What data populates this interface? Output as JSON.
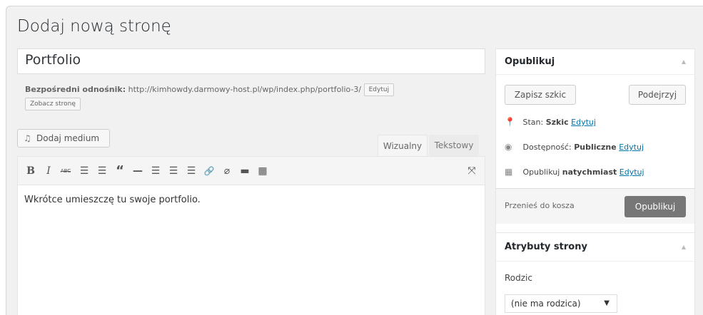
{
  "page": {
    "title": "Dodaj nową stronę"
  },
  "editor": {
    "post_title": "Portfolio",
    "permalink": {
      "label": "Bezpośredni odnośnik:",
      "url": "http://kimhowdy.darmowy-host.pl/wp/index.php/portfolio-3/",
      "edit_label": "Edytuj",
      "view_label": "Zobacz stronę"
    },
    "add_media_label": "Dodaj medium",
    "tabs": {
      "visual": "Wizualny",
      "text": "Tekstowy"
    },
    "toolbar": {
      "bold": "B",
      "italic": "I",
      "strike": "ABC",
      "ul": "☰",
      "ol": "☰",
      "quote": "“",
      "hr": "—",
      "align_left": "☰",
      "align_center": "☰",
      "align_right": "☰",
      "link": "🔗",
      "unlink": "⌀",
      "more": "▬",
      "kitchen": "▦",
      "fullscreen": "⤧"
    },
    "content": "Wkrótce umieszczę tu swoje portfolio."
  },
  "publish_box": {
    "title": "Opublikuj",
    "save_draft": "Zapisz szkic",
    "preview": "Podejrzyj",
    "status_label": "Stan:",
    "status_value": "Szkic",
    "visibility_label": "Dostępność:",
    "visibility_value": "Publiczne",
    "schedule_label": "Opublikuj",
    "schedule_value": "natychmiast",
    "edit_link": "Edytuj",
    "trash": "Przenieś do kosza",
    "publish": "Opublikuj"
  },
  "attributes_box": {
    "title": "Atrybuty strony",
    "parent_label": "Rodzic",
    "parent_value": "(nie ma rodzica)"
  }
}
